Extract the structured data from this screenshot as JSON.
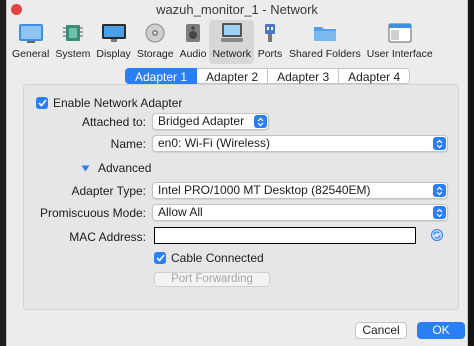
{
  "window": {
    "title": "wazuh_monitor_1 - Network"
  },
  "toolbar": {
    "items": [
      {
        "label": "General",
        "icon": "general-icon"
      },
      {
        "label": "System",
        "icon": "system-chip-icon"
      },
      {
        "label": "Display",
        "icon": "display-monitor-icon"
      },
      {
        "label": "Storage",
        "icon": "storage-disk-icon"
      },
      {
        "label": "Audio",
        "icon": "audio-speaker-icon"
      },
      {
        "label": "Network",
        "icon": "network-globe-icon",
        "active": true
      },
      {
        "label": "Ports",
        "icon": "ports-plug-icon"
      },
      {
        "label": "Shared Folders",
        "icon": "shared-folder-icon"
      },
      {
        "label": "User Interface",
        "icon": "user-interface-window-icon"
      }
    ]
  },
  "tabs": [
    {
      "label": "Adapter 1",
      "active": true
    },
    {
      "label": "Adapter 2"
    },
    {
      "label": "Adapter 3"
    },
    {
      "label": "Adapter 4"
    }
  ],
  "adapter": {
    "enable_label": "Enable Network Adapter",
    "enable_checked": true,
    "attached_label": "Attached to:",
    "attached_value": "Bridged Adapter",
    "name_label": "Name:",
    "name_value": "en0: Wi-Fi (Wireless)",
    "advanced_label": "Advanced",
    "adapter_type_label": "Adapter Type:",
    "adapter_type_value": "Intel PRO/1000 MT Desktop (82540EM)",
    "promiscuous_label": "Promiscuous Mode:",
    "promiscuous_value": "Allow All",
    "mac_label": "MAC Address:",
    "mac_value": "",
    "cable_label": "Cable Connected",
    "cable_checked": true,
    "port_forwarding_label": "Port Forwarding"
  },
  "footer": {
    "cancel_label": "Cancel",
    "ok_label": "OK"
  },
  "colors": {
    "accent": "#2a7ef6",
    "window_bg": "#ececec"
  }
}
